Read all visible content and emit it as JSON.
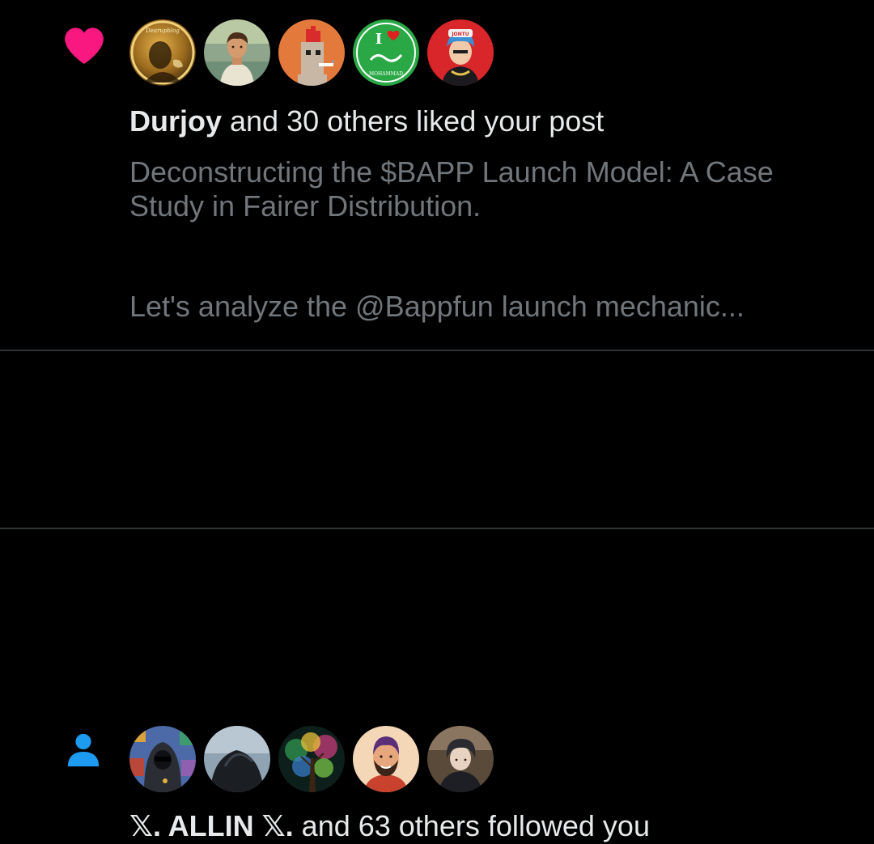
{
  "notifications": [
    {
      "type": "like",
      "icon": "heart-icon",
      "icon_color": "#f91880",
      "avatars": [
        {
          "name": "avatar-durjoy",
          "text": "Dearupblog"
        },
        {
          "name": "avatar-liker-2"
        },
        {
          "name": "avatar-liker-3"
        },
        {
          "name": "avatar-liker-4",
          "text_top": "I",
          "text_bottom": "MOHAMMAD"
        },
        {
          "name": "avatar-liker-5",
          "text": "JONTU"
        }
      ],
      "actor": "Durjoy",
      "action_text": " and 30 others liked your post",
      "post_preview": {
        "line1": "Deconstructing the $BAPP Launch Model: A Case Study in Fairer Distribution.",
        "line2": "Let's analyze the @Bappfun launch mechanic..."
      }
    },
    {
      "type": "follow",
      "icon": "person-icon",
      "icon_color": "#1d9bf0",
      "avatars": [
        {
          "name": "avatar-allin"
        },
        {
          "name": "avatar-follower-2"
        },
        {
          "name": "avatar-follower-3"
        },
        {
          "name": "avatar-follower-4"
        },
        {
          "name": "avatar-follower-5"
        }
      ],
      "actor": "𝕏. ALLIN 𝕏.",
      "action_text": " and 63 others followed you"
    }
  ],
  "colors": {
    "background": "#000000",
    "primary_text": "#e7e9ea",
    "secondary_text": "#71767b",
    "divider": "#2f3336"
  }
}
